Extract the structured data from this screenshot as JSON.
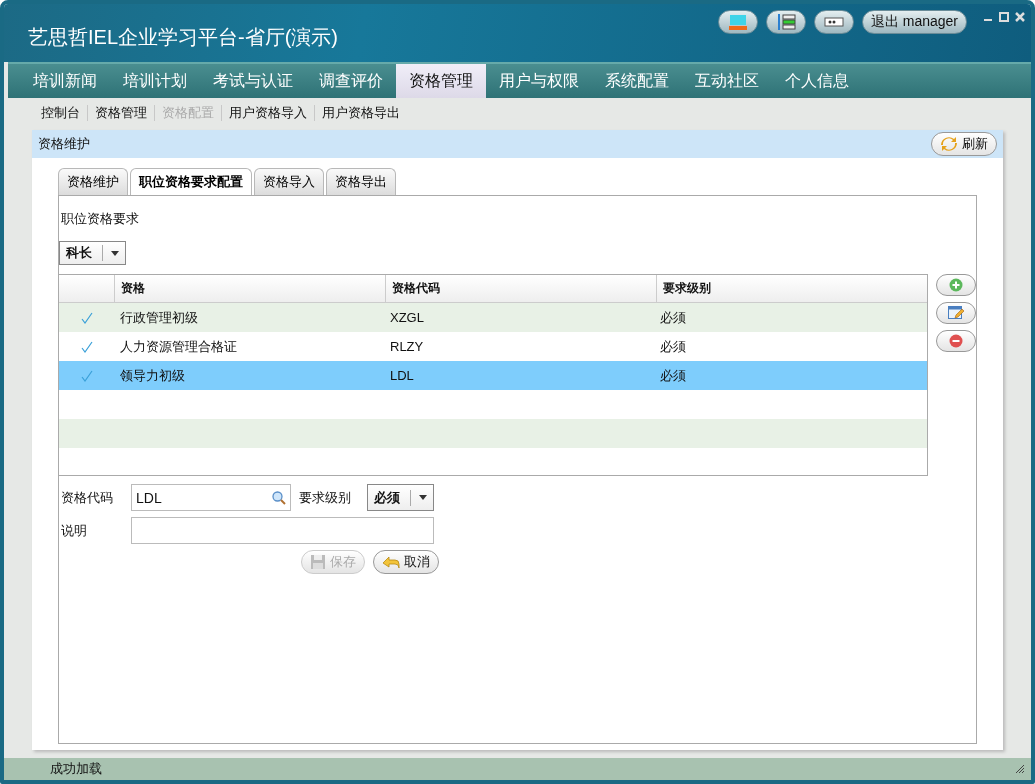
{
  "window": {
    "title": "艺思哲IEL企业学习平台-省厅(演示)",
    "logout_button": "退出 manager"
  },
  "nav": [
    {
      "label": "培训新闻",
      "selected": false
    },
    {
      "label": "培训计划",
      "selected": false
    },
    {
      "label": "考试与认证",
      "selected": false
    },
    {
      "label": "调查评价",
      "selected": false
    },
    {
      "label": "资格管理",
      "selected": true
    },
    {
      "label": "用户与权限",
      "selected": false
    },
    {
      "label": "系统配置",
      "selected": false
    },
    {
      "label": "互动社区",
      "selected": false
    },
    {
      "label": "个人信息",
      "selected": false
    }
  ],
  "subnav": [
    {
      "label": "控制台",
      "disabled": false
    },
    {
      "label": "资格管理",
      "disabled": false
    },
    {
      "label": "资格配置",
      "disabled": true
    },
    {
      "label": "用户资格导入",
      "disabled": false
    },
    {
      "label": "用户资格导出",
      "disabled": false
    }
  ],
  "panel": {
    "title": "资格维护",
    "refresh_button": "刷新"
  },
  "tabs": [
    {
      "label": "资格维护",
      "selected": false
    },
    {
      "label": "职位资格要求配置",
      "selected": true
    },
    {
      "label": "资格导入",
      "selected": false
    },
    {
      "label": "资格导出",
      "selected": false
    }
  ],
  "position": {
    "label": "职位资格要求",
    "value": "科长"
  },
  "table": {
    "columns": [
      "资格",
      "资格代码",
      "要求级别"
    ],
    "rows": [
      {
        "checked": true,
        "selected": false,
        "cells": [
          "行政管理初级",
          "XZGL",
          "必须"
        ]
      },
      {
        "checked": true,
        "selected": false,
        "cells": [
          "人力资源管理合格证",
          "RLZY",
          "必须"
        ]
      },
      {
        "checked": true,
        "selected": true,
        "cells": [
          "领导力初级",
          "LDL",
          "必须"
        ]
      }
    ]
  },
  "form": {
    "code_label": "资格代码",
    "code_value": "LDL",
    "level_label": "要求级别",
    "level_value": "必须",
    "note_label": "说明",
    "save_button": {
      "label": "保存",
      "disabled": true
    },
    "cancel_button": {
      "label": "取消",
      "disabled": false
    }
  },
  "status_bar": "成功加载"
}
